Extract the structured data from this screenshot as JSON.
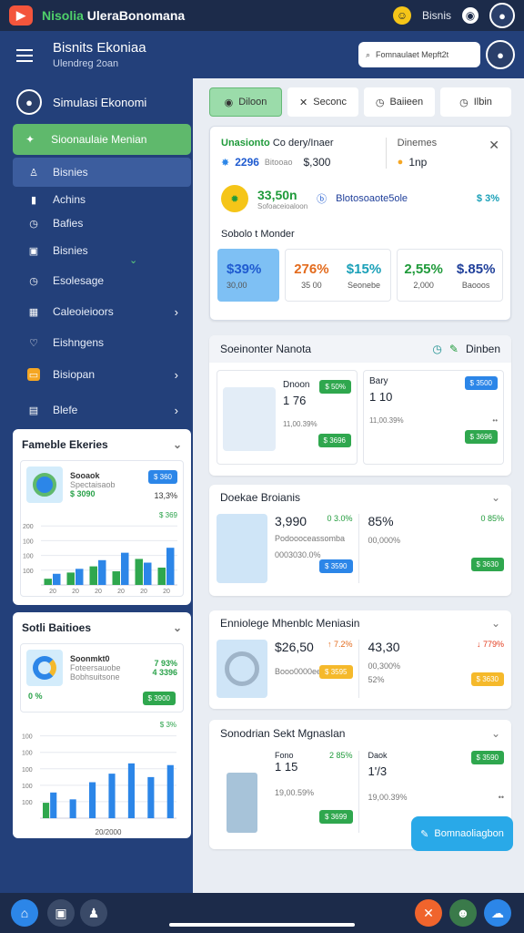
{
  "app": {
    "title_green": "Nisolia",
    "title_white": "UleraBonomana",
    "user_label": "Bisnis",
    "logo_char": "▶"
  },
  "header": {
    "title": "Bisnits Ekoniaa",
    "subtitle": "Ulendreg 2oan",
    "search_placeholder": "Fomnaulaet Mepft2t"
  },
  "sidebar": {
    "user_name": "Simulasi Ekonomi",
    "active_item": "Sioonaulaie Menian",
    "items": [
      {
        "label": "Bisnies",
        "icon": "person-icon",
        "selected": true
      },
      {
        "label": "Achins",
        "icon": "chart-icon"
      },
      {
        "label": "Bafies",
        "icon": "clock-icon"
      },
      {
        "label": "Bisnies",
        "icon": "building-icon"
      },
      {
        "label": "Esolesage",
        "icon": "clock-icon"
      },
      {
        "label": "Caleoieioors",
        "icon": "grid-icon",
        "chevron": true
      },
      {
        "label": "Eishngens",
        "icon": "heart-icon"
      },
      {
        "label": "Bisiopan",
        "icon": "wallet-icon",
        "chevron": true
      },
      {
        "label": "Blefe",
        "icon": "calendar-icon",
        "chevron": true
      }
    ]
  },
  "left_panel_1": {
    "title": "Fameble Ekeries",
    "row_title": "Sooaok",
    "row_sub": "Spectaisaob",
    "row_green": "$ 3090",
    "row_pill": "$ 360",
    "row_value": "13,3%",
    "chart_top_label": "$ 369",
    "chart_data": {
      "type": "bar",
      "ylim": [
        0,
        100
      ],
      "yticks": [
        "100",
        "100",
        "100",
        "200"
      ],
      "categories": [
        "20",
        "20",
        "20",
        "20",
        "20",
        "20"
      ],
      "series": [
        {
          "name": "",
          "values": [
            18,
            26,
            40,
            52,
            36,
            60
          ],
          "color": "#2c86e8"
        },
        {
          "name": "",
          "values": [
            10,
            20,
            30,
            22,
            42,
            28
          ],
          "color": "#2fa74e"
        }
      ]
    }
  },
  "left_panel_2": {
    "title": "Sotli Baitioes",
    "row_title": "Soonmkt0",
    "row_sub1": "Foteersauobe",
    "row_sub2": "Bobhsuitsone",
    "row_green1": "7 93%",
    "row_green2": "4 3396",
    "row_small": "0 %",
    "row_pill": "$ 3900",
    "chart_top_label": "$ 3%",
    "xlabel": "20/2000",
    "chart_data": {
      "type": "bar",
      "ylim": [
        0,
        100
      ],
      "yticks": [
        "100",
        "100",
        "100",
        "100",
        "100"
      ],
      "categories": [
        "",
        "",
        "",
        "",
        "",
        "",
        ""
      ],
      "series": [
        {
          "name": "",
          "values": [
            30,
            22,
            42,
            52,
            64,
            48,
            62
          ],
          "color": "#2c86e8"
        },
        {
          "name": "",
          "values": [
            18,
            0,
            0,
            0,
            0,
            0,
            0
          ],
          "color": "#2fa74e"
        }
      ]
    }
  },
  "tabs": [
    {
      "label": "Diloon",
      "icon": "leaf-icon"
    },
    {
      "label": "Seconc",
      "icon": "close-icon"
    },
    {
      "label": "Baiieen",
      "icon": "clock-icon"
    },
    {
      "label": "Ilbin",
      "icon": "clock-icon"
    }
  ],
  "card1": {
    "title_green": "Unasionto",
    "title_rest": "Co dery/Inaer",
    "badge_right": "Dinemes",
    "v1": "2296",
    "v1_sub": "Bitooao",
    "v2": "$,300",
    "v3": "1np",
    "kpi_value": "33,50n",
    "kpi_sub": "Sofoaceioaloon",
    "kpi_mid": "Blotosoaote5ole",
    "kpi_right": "$ 3%",
    "section_title": "Sobolo t Monder",
    "stats": [
      {
        "value": "$39%",
        "label": "30,00",
        "color": "#1f5bd0"
      },
      {
        "value": "276%",
        "label": "35 00",
        "color": "#e36b1d"
      },
      {
        "value": "$15%",
        "label": "Seonebe",
        "color": "#1aa0b8"
      },
      {
        "value": "2,55%",
        "label": "2,000",
        "color": "#1f9a3a"
      },
      {
        "value": "$.85%",
        "label": "Baooos",
        "color": "#1f3f9a"
      }
    ]
  },
  "card2": {
    "title": "Soeinonter Nanota",
    "right_label": "Dinben",
    "left": {
      "name": "Dnoon",
      "value": "1 76",
      "date": "11,00.39%",
      "pill_top": "$ 50%",
      "pill_bottom": "$ 3696"
    },
    "right": {
      "name": "Bary",
      "value": "1 10",
      "date": "11,00.39%",
      "pill_top": "$ 3500",
      "pill_bottom": "$ 3696",
      "dots": "••"
    }
  },
  "card3": {
    "title": "Doekae Broianis",
    "left": {
      "value": "3,990",
      "green": "0 3.0%",
      "sub": "Podoooceassomba",
      "sub2": "0003030.0%",
      "pill": "$ 3590"
    },
    "right": {
      "value": "85%",
      "green": "0 85%",
      "sub": "00,000%",
      "pill": "$ 3630"
    }
  },
  "card4": {
    "title": "Enniolege Mhenblc Meniasin",
    "left": {
      "value": "$26,50",
      "change": "7.2%",
      "sub": "Booo0000ee",
      "pill": "$ 3595"
    },
    "right": {
      "value": "43,30",
      "change": "779%",
      "sub": "00,300%",
      "sub2": "52%",
      "pill": "$ 3630"
    }
  },
  "card5": {
    "title": "Sonodrian Sekt Mgnaslan",
    "left": {
      "name": "Fono",
      "value": "1 15",
      "green": "2 85%",
      "date": "19,00.59%",
      "pill": "$ 3699"
    },
    "right": {
      "name": "Daok",
      "value": "1'/3",
      "pill_top": "$ 3590",
      "date": "19,00.39%",
      "dots": "••"
    }
  },
  "float_button": {
    "label": "Bomnaoliagbon"
  }
}
